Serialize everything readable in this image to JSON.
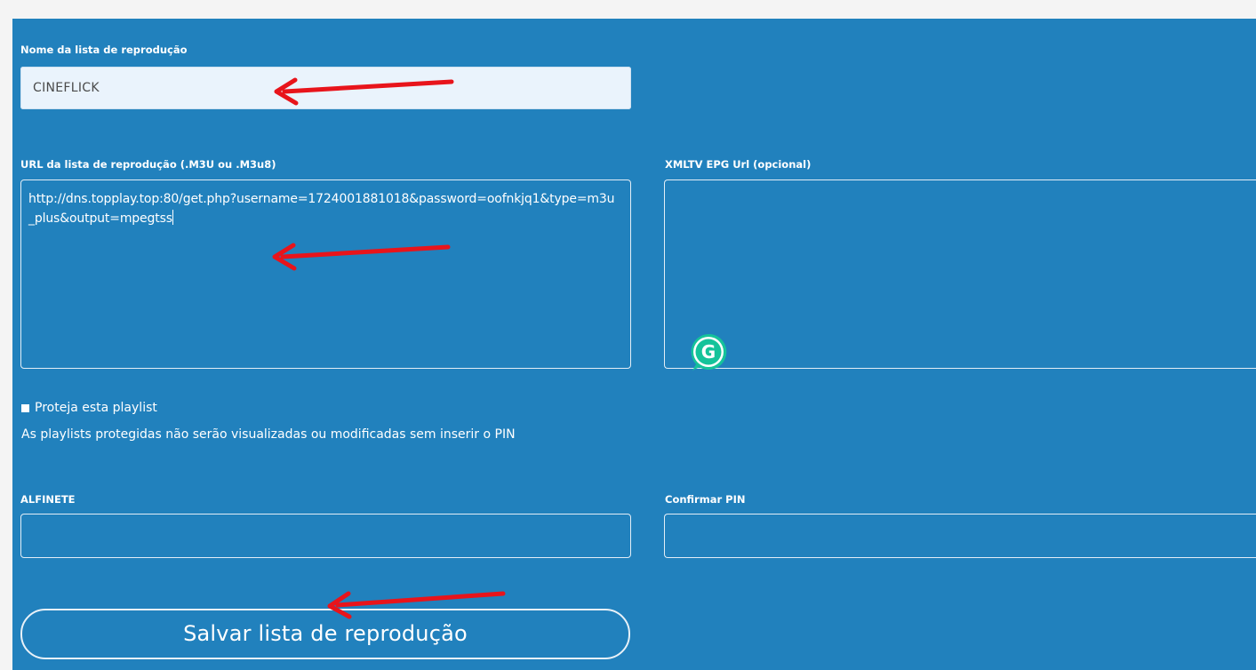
{
  "form": {
    "name_label": "Nome da lista de reprodução",
    "name_value": "CINEFLICK",
    "url_label": "URL da lista de reprodução (.M3U ou .M3u8)",
    "url_value": "http://dns.topplay.top:80/get.php?username=1724001881018&password=oofnkjq1&type=m3u_plus&output=mpegtss",
    "epg_label": "XMLTV EPG Url (opcional)",
    "epg_value": "",
    "protect_label": "Proteja esta playlist",
    "protect_checked": true,
    "protect_hint": "As playlists protegidas não serão visualizadas ou modificadas sem inserir o PIN",
    "pin_label": "ALFINETE",
    "pin_value": "",
    "confirm_pin_label": "Confirmar PIN",
    "confirm_pin_value": "",
    "save_label": "Salvar lista de reprodução"
  },
  "grammarly_icon_letter": "G",
  "colors": {
    "panel_background": "#2181bd",
    "page_background": "#f4f4f4",
    "input_background": "#eaf3fc",
    "annotation_arrow": "#e8141b",
    "grammarly_green": "#15c39a"
  }
}
